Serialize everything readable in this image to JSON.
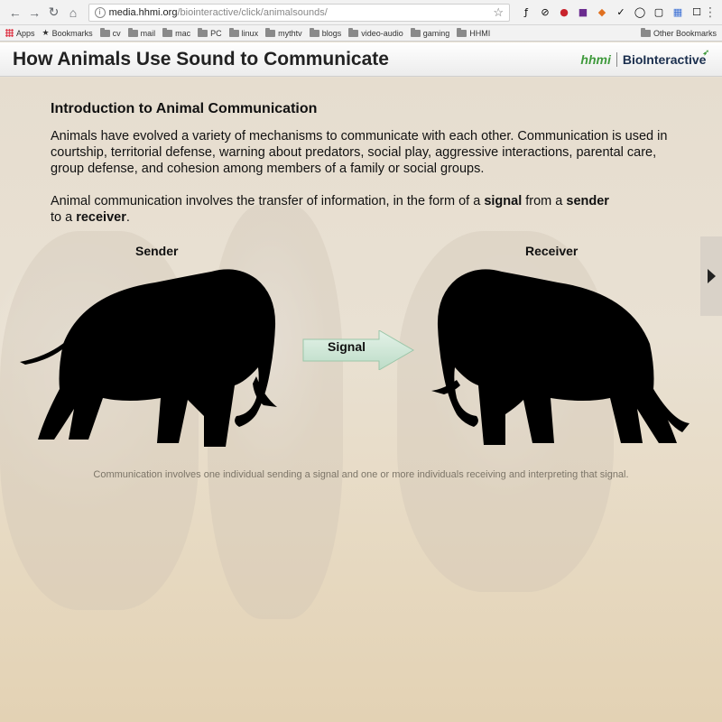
{
  "browser": {
    "url_host": "media.hhmi.org",
    "url_path": "/biointeractive/click/animalsounds/",
    "bookmarks": [
      "Apps",
      "Bookmarks",
      "cv",
      "mail",
      "mac",
      "PC",
      "linux",
      "mythtv",
      "blogs",
      "video-audio",
      "gaming",
      "HHMI"
    ],
    "other_bookmarks": "Other Bookmarks"
  },
  "header": {
    "title": "How Animals Use Sound to Communicate",
    "brand_hhmi": "hhmi",
    "brand_bio": "BioInteractive"
  },
  "content": {
    "heading": "Introduction to Animal Communication",
    "paragraph1": "Animals have evolved a variety of mechanisms to communicate with each other. Communication is used in courtship, territorial defense, warning about predators, social play, aggressive interactions, parental care, group defense, and cohesion among members of a family or social groups.",
    "p2_a": "Animal communication involves the transfer of information, in the form of a ",
    "p2_signal": "signal",
    "p2_b": " from a ",
    "p2_sender": "sender",
    "p2_c": " to a ",
    "p2_receiver": "receiver",
    "p2_d": ".",
    "sender_label": "Sender",
    "receiver_label": "Receiver",
    "signal_label": "Signal",
    "caption": "Communication involves one individual sending a signal and one or more individuals receiving and interpreting that signal."
  },
  "colors": {
    "hhmi_green": "#3f9a3c",
    "bio_navy": "#1b2f4e",
    "signal_arrow": "#cfe6d6"
  }
}
